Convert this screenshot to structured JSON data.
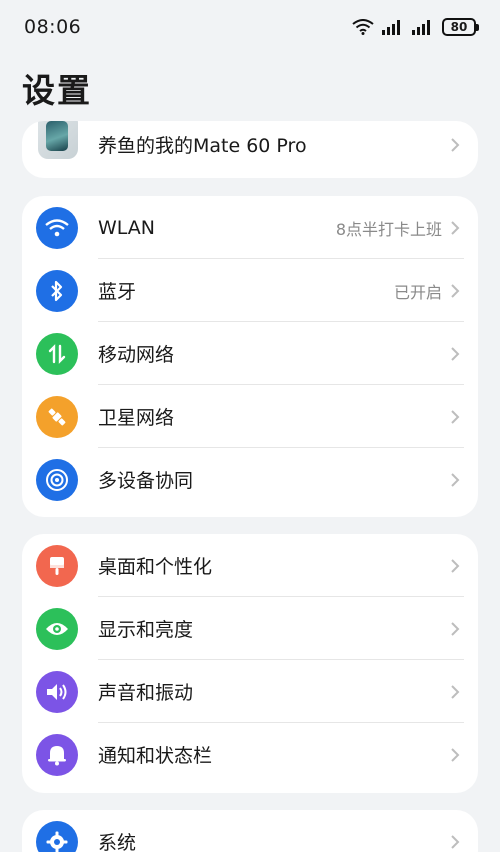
{
  "status_bar": {
    "time": "08:06",
    "battery": "80"
  },
  "title": "设置",
  "device": {
    "name": "养鱼的我的Mate 60 Pro"
  },
  "group1": [
    {
      "label": "WLAN",
      "value": "8点半打卡上班",
      "icon": "wifi-icon",
      "color": "#1f6fe5"
    },
    {
      "label": "蓝牙",
      "value": "已开启",
      "icon": "bluetooth-icon",
      "color": "#1f6fe5"
    },
    {
      "label": "移动网络",
      "value": "",
      "icon": "mobile-data-icon",
      "color": "#2cc05a"
    },
    {
      "label": "卫星网络",
      "value": "",
      "icon": "satellite-icon",
      "color": "#f4a12b"
    },
    {
      "label": "多设备协同",
      "value": "",
      "icon": "multi-device-icon",
      "color": "#1f6fe5"
    }
  ],
  "group2": [
    {
      "label": "桌面和个性化",
      "icon": "brush-icon",
      "color": "#f2674f"
    },
    {
      "label": "显示和亮度",
      "icon": "eye-icon",
      "color": "#2cc05a"
    },
    {
      "label": "声音和振动",
      "icon": "speaker-icon",
      "color": "#7c54e6"
    },
    {
      "label": "通知和状态栏",
      "icon": "bell-icon",
      "color": "#7c54e6"
    }
  ],
  "group3": [
    {
      "label": "系统",
      "icon": "gear-icon",
      "color": "#1f6fe5"
    }
  ]
}
